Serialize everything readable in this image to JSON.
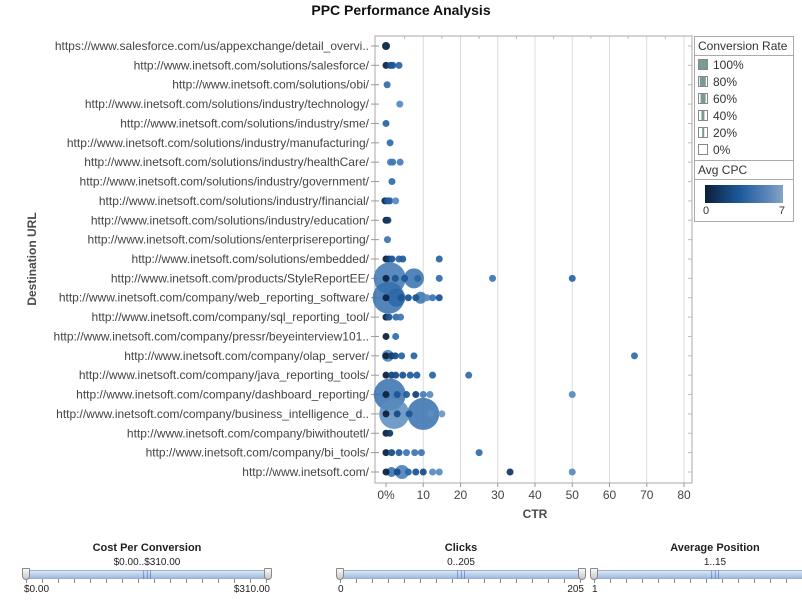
{
  "chart_data": {
    "type": "scatter",
    "title": "PPC Performance Analysis",
    "xlabel": "CTR",
    "ylabel": "Destination URL",
    "xlim": [
      -3,
      81
    ],
    "x_ticks": [
      {
        "value": 0,
        "label": "0%"
      },
      {
        "value": 10,
        "label": "10"
      },
      {
        "value": 20,
        "label": "20"
      },
      {
        "value": 30,
        "label": "30"
      },
      {
        "value": 40,
        "label": "40"
      },
      {
        "value": 50,
        "label": "50"
      },
      {
        "value": 60,
        "label": "60"
      },
      {
        "value": 70,
        "label": "70"
      },
      {
        "value": 80,
        "label": "80"
      }
    ],
    "grid": "vertical",
    "legend_position": "right",
    "categories": [
      "https://www.salesforce.com/us/appexchange/detail_overvi..",
      "http://www.inetsoft.com/solutions/salesforce/",
      "http://www.inetsoft.com/solutions/obi/",
      "http://www.inetsoft.com/solutions/industry/technology/",
      "http://www.inetsoft.com/solutions/industry/sme/",
      "http://www.inetsoft.com/solutions/industry/manufacturing/",
      "http://www.inetsoft.com/solutions/industry/healthCare/",
      "http://www.inetsoft.com/solutions/industry/government/",
      "http://www.inetsoft.com/solutions/industry/financial/",
      "http://www.inetsoft.com/solutions/industry/education/",
      "http://www.inetsoft.com/solutions/enterprisereporting/",
      "http://www.inetsoft.com/solutions/embedded/",
      "http://www.inetsoft.com/products/StyleReportEE/",
      "http://www.inetsoft.com/company/web_reporting_software/",
      "http://www.inetsoft.com/company/sql_reporting_tool/",
      "http://www.inetsoft.com/company/pressr/beyeinterview101..",
      "http://www.inetsoft.com/company/olap_server/",
      "http://www.inetsoft.com/company/java_reporting_tools/",
      "http://www.inetsoft.com/company/dashboard_reporting/",
      "http://www.inetsoft.com/company/business_intelligence_d..",
      "http://www.inetsoft.com/company/biwithoutetl/",
      "http://www.inetsoft.com/company/bi_tools/",
      "http://www.inetsoft.com/"
    ],
    "size_legend": {
      "title": "Conversion Rate",
      "items": [
        "100%",
        "80%",
        "60%",
        "40%",
        "20%",
        "0%"
      ]
    },
    "color_legend": {
      "title": "Avg CPC",
      "min": "0",
      "max": "7",
      "colors": [
        "#0b1f3a",
        "#1d5a9c",
        "#86a4c4"
      ]
    },
    "points": [
      {
        "row": 0,
        "x": 0,
        "cpc": 0.3,
        "r": 4
      },
      {
        "row": 1,
        "x": 0,
        "cpc": 0.5,
        "r": 3.5
      },
      {
        "row": 1,
        "x": 1.2,
        "cpc": 2.5,
        "r": 3.5
      },
      {
        "row": 1,
        "x": 1.8,
        "cpc": 3,
        "r": 3.5
      },
      {
        "row": 1,
        "x": 3.5,
        "cpc": 4,
        "r": 3.5
      },
      {
        "row": 2,
        "x": 0.3,
        "cpc": 4.5,
        "r": 3.5
      },
      {
        "row": 3,
        "x": 3.7,
        "cpc": 6,
        "r": 3.5
      },
      {
        "row": 4,
        "x": 0,
        "cpc": 4,
        "r": 3.5
      },
      {
        "row": 5,
        "x": 1.1,
        "cpc": 4.5,
        "r": 3.5
      },
      {
        "row": 6,
        "x": 1.2,
        "cpc": 5.5,
        "r": 3.5
      },
      {
        "row": 6,
        "x": 1.8,
        "cpc": 5,
        "r": 3.5
      },
      {
        "row": 6,
        "x": 3.8,
        "cpc": 5.5,
        "r": 3.5
      },
      {
        "row": 7,
        "x": 1.6,
        "cpc": 4.5,
        "r": 3.5
      },
      {
        "row": 8,
        "x": -0.3,
        "cpc": 0.8,
        "r": 3.5
      },
      {
        "row": 8,
        "x": 0.4,
        "cpc": 3,
        "r": 3.5
      },
      {
        "row": 8,
        "x": 1.0,
        "cpc": 3.5,
        "r": 3.5
      },
      {
        "row": 8,
        "x": 2.6,
        "cpc": 6,
        "r": 3.5
      },
      {
        "row": 9,
        "x": 0,
        "cpc": 0.2,
        "r": 3.5
      },
      {
        "row": 9,
        "x": 0.5,
        "cpc": 1.5,
        "r": 3.5
      },
      {
        "row": 10,
        "x": 0.4,
        "cpc": 5,
        "r": 3.5
      },
      {
        "row": 11,
        "x": 0,
        "cpc": 0.2,
        "r": 3.5
      },
      {
        "row": 11,
        "x": 0.8,
        "cpc": 1.5,
        "r": 3.5
      },
      {
        "row": 11,
        "x": 1.6,
        "cpc": 3,
        "r": 3.5
      },
      {
        "row": 11,
        "x": 3.5,
        "cpc": 4,
        "r": 3.5
      },
      {
        "row": 11,
        "x": 4.5,
        "cpc": 3.5,
        "r": 3.5
      },
      {
        "row": 11,
        "x": 14.3,
        "cpc": 4,
        "r": 3.5
      },
      {
        "row": 12,
        "x": 1.0,
        "cpc": 4.8,
        "r": 16
      },
      {
        "row": 12,
        "x": 0,
        "cpc": 0.3,
        "r": 3.5
      },
      {
        "row": 12,
        "x": 2.5,
        "cpc": 3,
        "r": 3.5
      },
      {
        "row": 12,
        "x": 5.0,
        "cpc": 3,
        "r": 3.5
      },
      {
        "row": 12,
        "x": 7.5,
        "cpc": 4.5,
        "r": 10
      },
      {
        "row": 12,
        "x": 8.5,
        "cpc": 4,
        "r": 3.5
      },
      {
        "row": 12,
        "x": 14.3,
        "cpc": 4.5,
        "r": 3.5
      },
      {
        "row": 12,
        "x": 28.6,
        "cpc": 5,
        "r": 3.5
      },
      {
        "row": 12,
        "x": 50,
        "cpc": 4,
        "r": 3.5
      },
      {
        "row": 13,
        "x": 0.7,
        "cpc": 4.5,
        "r": 16
      },
      {
        "row": 13,
        "x": 2.8,
        "cpc": 4,
        "r": 9
      },
      {
        "row": 13,
        "x": 0,
        "cpc": 0.3,
        "r": 3.5
      },
      {
        "row": 13,
        "x": 4,
        "cpc": 3,
        "r": 3.5
      },
      {
        "row": 13,
        "x": 6,
        "cpc": 3,
        "r": 3.5
      },
      {
        "row": 13,
        "x": 8,
        "cpc": 3,
        "r": 3.5
      },
      {
        "row": 13,
        "x": 9.3,
        "cpc": 4.5,
        "r": 6
      },
      {
        "row": 13,
        "x": 11,
        "cpc": 6,
        "r": 3.5
      },
      {
        "row": 13,
        "x": 12.5,
        "cpc": 5,
        "r": 3.5
      },
      {
        "row": 13,
        "x": 14.3,
        "cpc": 3,
        "r": 3.5
      },
      {
        "row": 14,
        "x": 0,
        "cpc": 0.5,
        "r": 3.5
      },
      {
        "row": 14,
        "x": 0.8,
        "cpc": 3,
        "r": 3.5
      },
      {
        "row": 14,
        "x": 2.7,
        "cpc": 4.5,
        "r": 3.5
      },
      {
        "row": 14,
        "x": 3.9,
        "cpc": 5,
        "r": 3.5
      },
      {
        "row": 15,
        "x": 0,
        "cpc": 0.3,
        "r": 3.5
      },
      {
        "row": 15,
        "x": 2.6,
        "cpc": 4.5,
        "r": 3.5
      },
      {
        "row": 16,
        "x": 0.5,
        "cpc": 5.5,
        "r": 6
      },
      {
        "row": 16,
        "x": 0,
        "cpc": 0.2,
        "r": 3.5
      },
      {
        "row": 16,
        "x": 1.5,
        "cpc": 1.5,
        "r": 3.5
      },
      {
        "row": 16,
        "x": 2.5,
        "cpc": 2.5,
        "r": 3.5
      },
      {
        "row": 16,
        "x": 4.2,
        "cpc": 4,
        "r": 3.5
      },
      {
        "row": 16,
        "x": 7.5,
        "cpc": 4,
        "r": 3.5
      },
      {
        "row": 16,
        "x": 66.7,
        "cpc": 4.5,
        "r": 3.5
      },
      {
        "row": 17,
        "x": 0,
        "cpc": 0.2,
        "r": 3.5
      },
      {
        "row": 17,
        "x": 1.5,
        "cpc": 2,
        "r": 3.5
      },
      {
        "row": 17,
        "x": 2.6,
        "cpc": 2.5,
        "r": 3.5
      },
      {
        "row": 17,
        "x": 4.5,
        "cpc": 3,
        "r": 3.5
      },
      {
        "row": 17,
        "x": 6.5,
        "cpc": 3.5,
        "r": 3.5
      },
      {
        "row": 17,
        "x": 8.3,
        "cpc": 3.5,
        "r": 3.5
      },
      {
        "row": 17,
        "x": 12.5,
        "cpc": 4,
        "r": 3.5
      },
      {
        "row": 17,
        "x": 22.2,
        "cpc": 4.5,
        "r": 3.5
      },
      {
        "row": 18,
        "x": 1.0,
        "cpc": 4.5,
        "r": 16
      },
      {
        "row": 18,
        "x": 0,
        "cpc": 0.2,
        "r": 3.5
      },
      {
        "row": 18,
        "x": 3,
        "cpc": 3,
        "r": 3.5
      },
      {
        "row": 18,
        "x": 5.5,
        "cpc": 3.5,
        "r": 3.5
      },
      {
        "row": 18,
        "x": 8,
        "cpc": 2,
        "r": 3.5
      },
      {
        "row": 18,
        "x": 10,
        "cpc": 5.5,
        "r": 3.5
      },
      {
        "row": 18,
        "x": 11.8,
        "cpc": 6,
        "r": 3.5
      },
      {
        "row": 18,
        "x": 50,
        "cpc": 6,
        "r": 3.5
      },
      {
        "row": 19,
        "x": 2.2,
        "cpc": 6,
        "r": 15
      },
      {
        "row": 19,
        "x": 10,
        "cpc": 4.5,
        "r": 16
      },
      {
        "row": 19,
        "x": 0,
        "cpc": 0.2,
        "r": 3.5
      },
      {
        "row": 19,
        "x": 3,
        "cpc": 2.5,
        "r": 3.5
      },
      {
        "row": 19,
        "x": 6.2,
        "cpc": 3,
        "r": 3.5
      },
      {
        "row": 19,
        "x": 12,
        "cpc": 6,
        "r": 3.5
      },
      {
        "row": 19,
        "x": 15,
        "cpc": 6.5,
        "r": 3.5
      },
      {
        "row": 20,
        "x": 0,
        "cpc": 0.2,
        "r": 3.5
      },
      {
        "row": 20,
        "x": 1.0,
        "cpc": 1.5,
        "r": 3.5
      },
      {
        "row": 21,
        "x": 0,
        "cpc": 0.2,
        "r": 3.5
      },
      {
        "row": 21,
        "x": 1.5,
        "cpc": 2.5,
        "r": 3.5
      },
      {
        "row": 21,
        "x": 3.5,
        "cpc": 3.5,
        "r": 3.5
      },
      {
        "row": 21,
        "x": 5.5,
        "cpc": 5,
        "r": 3.5
      },
      {
        "row": 21,
        "x": 7.7,
        "cpc": 5,
        "r": 3.5
      },
      {
        "row": 21,
        "x": 9.5,
        "cpc": 5,
        "r": 3.5
      },
      {
        "row": 21,
        "x": 25,
        "cpc": 4.5,
        "r": 3.5
      },
      {
        "row": 22,
        "x": 4.3,
        "cpc": 5,
        "r": 7
      },
      {
        "row": 22,
        "x": 1.5,
        "cpc": 5,
        "r": 5
      },
      {
        "row": 22,
        "x": 0,
        "cpc": 0.2,
        "r": 3.5
      },
      {
        "row": 22,
        "x": 3,
        "cpc": 2.5,
        "r": 3.5
      },
      {
        "row": 22,
        "x": 6,
        "cpc": 4,
        "r": 3.5
      },
      {
        "row": 22,
        "x": 8,
        "cpc": 3,
        "r": 3.5
      },
      {
        "row": 22,
        "x": 10,
        "cpc": 2.5,
        "r": 3.5
      },
      {
        "row": 22,
        "x": 12.5,
        "cpc": 6,
        "r": 3.5
      },
      {
        "row": 22,
        "x": 14.3,
        "cpc": 6,
        "r": 3.5
      },
      {
        "row": 22,
        "x": 33.3,
        "cpc": 1.5,
        "r": 3.5
      },
      {
        "row": 22,
        "x": 50,
        "cpc": 6,
        "r": 3.5
      }
    ]
  },
  "filters": [
    {
      "title": "Cost Per Conversion",
      "range": "$0.00..$310.00",
      "min": "$0.00",
      "max": "$310.00",
      "low_fraction": 0,
      "high_fraction": 1
    },
    {
      "title": "Clicks",
      "range": "0..205",
      "min": "0",
      "max": "205",
      "low_fraction": 0,
      "high_fraction": 1
    },
    {
      "title": "Average Position",
      "range": "1..15",
      "min": "1",
      "max": "15",
      "low_fraction": 0,
      "high_fraction": 1
    }
  ]
}
